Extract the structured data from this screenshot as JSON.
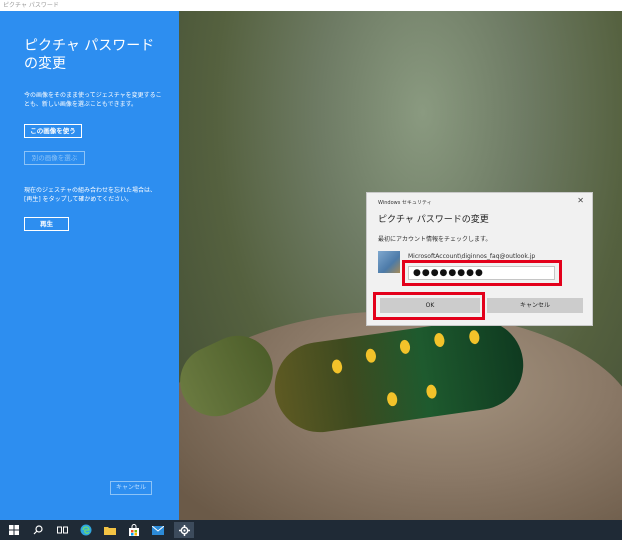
{
  "window": {
    "title": "ピクチャ パスワード"
  },
  "left_panel": {
    "title": "ピクチャ パスワードの変更",
    "desc1": "今の画像をそのまま使ってジェスチャを変更することも、新しい画像を選ぶこともできます。",
    "use_image_button": "この画像を使う",
    "choose_image_button": "別の画像を選ぶ",
    "desc2": "現在のジェスチャの組み合わせを忘れた場合は、[再生] をタップして確かめてください。",
    "replay_button": "再生",
    "cancel_button": "キャンセル"
  },
  "dialog": {
    "caption": "Windows セキュリティ",
    "close_glyph": "✕",
    "title": "ピクチャ パスワードの変更",
    "message": "最初にアカウント情報をチェックします。",
    "account": "MicrosoftAccount\\diginnos_faq@outlook.jp",
    "password_masked": "●●●●●●●●",
    "ok_label": "OK",
    "cancel_label": "キャンセル"
  },
  "annotation_color": "#e3001b",
  "accent_color": "#2d8ef0",
  "taskbar": {
    "icons": [
      "windows-start-icon",
      "search-icon",
      "task-view-icon",
      "edge-icon",
      "file-explorer-icon",
      "store-icon",
      "mail-icon",
      "settings-icon"
    ]
  }
}
